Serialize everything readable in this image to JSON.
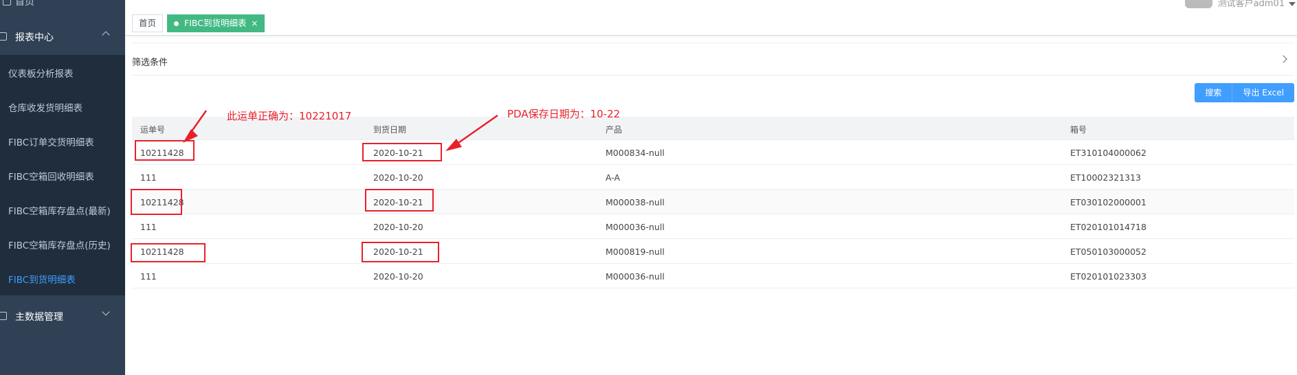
{
  "sidebar": {
    "top_label": "首页",
    "report_center": {
      "label": "报表中心"
    },
    "items": [
      {
        "label": "仪表板分析报表"
      },
      {
        "label": "仓库收发货明细表"
      },
      {
        "label": "FIBC订单交货明细表"
      },
      {
        "label": "FIBC空箱回收明细表"
      },
      {
        "label": "FIBC空箱库存盘点(最新)"
      },
      {
        "label": "FIBC空箱库存盘点(历史)"
      },
      {
        "label": "FIBC到货明细表",
        "active": true
      }
    ],
    "master_data": {
      "label": "主数据管理"
    }
  },
  "header": {
    "user_label": "测试客户adm01",
    "tabs": [
      {
        "label": "首页"
      },
      {
        "label": "FIBC到货明细表",
        "close": "×"
      }
    ]
  },
  "filter": {
    "title": "筛选条件"
  },
  "toolbar": {
    "search_label": "搜索",
    "export_label": "导出 Excel"
  },
  "table": {
    "columns": [
      "运单号",
      "到货日期",
      "产品",
      "箱号"
    ],
    "rows": [
      [
        "10211428",
        "2020-10-21",
        "M000834-null",
        "ET310104000062"
      ],
      [
        "111",
        "2020-10-20",
        "A-A",
        "ET10002321313"
      ],
      [
        "10211428",
        "2020-10-21",
        "M000038-null",
        "ET030102000001"
      ],
      [
        "111",
        "2020-10-20",
        "M000036-null",
        "ET020101014718"
      ],
      [
        "10211428",
        "2020-10-21",
        "M000819-null",
        "ET050103000052"
      ],
      [
        "111",
        "2020-10-20",
        "M000036-null",
        "ET020101023303"
      ]
    ]
  },
  "annotations": {
    "waybill_note": "此运单正确为：10221017",
    "pda_note": "PDA保存日期为：10-22",
    "color": "#e8202a"
  }
}
